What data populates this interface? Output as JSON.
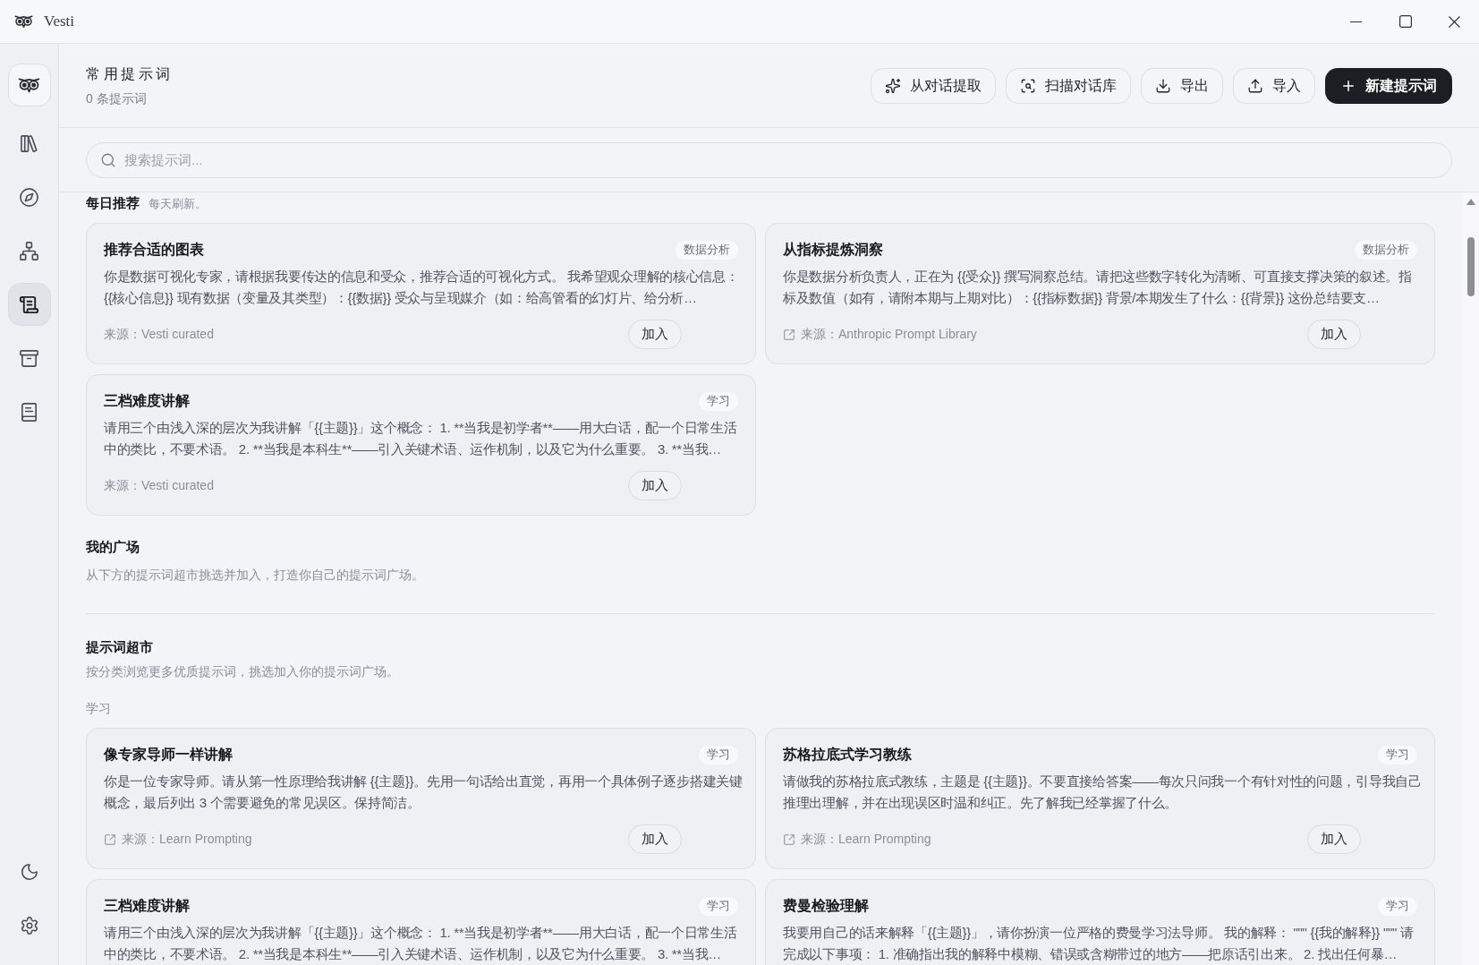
{
  "window": {
    "title": "Vesti"
  },
  "sidebar": {
    "items": [
      {
        "selected": false
      },
      {
        "selected": false
      },
      {
        "selected": false
      },
      {
        "selected": true
      },
      {
        "selected": false
      },
      {
        "selected": false
      }
    ]
  },
  "header": {
    "title": "常用提示词",
    "count": "0 条提示词",
    "buttons": [
      {
        "label": "从对话提取",
        "primary": false
      },
      {
        "label": "扫描对话库",
        "primary": false
      },
      {
        "label": "导出",
        "primary": false
      },
      {
        "label": "导入",
        "primary": false
      },
      {
        "label": "新建提示词",
        "primary": true
      }
    ]
  },
  "search": {
    "placeholder": "搜索提示词..."
  },
  "daily": {
    "title": "每日推荐",
    "note": "每天刷新。",
    "cards": [
      {
        "title": "推荐合适的图表",
        "tag": "数据分析",
        "description": "你是数据可视化专家，请根据我要传达的信息和受众，推荐合适的可视化方式。 我希望观众理解的核心信息：{{核心信息}} 现有数据（变量及其类型）：{{数据}} 受众与呈现媒介（如：给高管看的幻灯片、给分析…",
        "source": "来源：Vesti curated",
        "external": false,
        "action": "加入"
      },
      {
        "title": "从指标提炼洞察",
        "tag": "数据分析",
        "description": "你是数据分析负责人，正在为 {{受众}} 撰写洞察总结。请把这些数字转化为清晰、可直接支撑决策的叙述。指标及数值（如有，请附本期与上期对比）：{{指标数据}} 背景/本期发生了什么：{{背景}} 这份总结要支…",
        "source": "来源：Anthropic Prompt Library",
        "external": true,
        "action": "加入"
      },
      {
        "title": "三档难度讲解",
        "tag": "学习",
        "description": "请用三个由浅入深的层次为我讲解「{{主题}}」这个概念： 1. **当我是初学者**——用大白话，配一个日常生活中的类比，不要术语。 2. **当我是本科生**——引入关键术语、运作机制，以及它为什么重要。 3. **当我…",
        "source": "来源：Vesti curated",
        "external": false,
        "action": "加入"
      }
    ]
  },
  "my_square": {
    "title": "我的广场",
    "description": "从下方的提示词超市挑选并加入，打造你自己的提示词广场。"
  },
  "market": {
    "title": "提示词超市",
    "description": "按分类浏览更多优质提示词，挑选加入你的提示词广场。",
    "categories": [
      {
        "name": "学习",
        "cards": [
          {
            "title": "像专家导师一样讲解",
            "tag": "学习",
            "description": "你是一位专家导师。请从第一性原理给我讲解 {{主题}}。先用一句话给出直觉，再用一个具体例子逐步搭建关键概念，最后列出 3 个需要避免的常见误区。保持简洁。",
            "source": "来源：Learn Prompting",
            "external": true,
            "action": "加入"
          },
          {
            "title": "苏格拉底式学习教练",
            "tag": "学习",
            "description": "请做我的苏格拉底式教练，主题是 {{主题}}。不要直接给答案——每次只问我一个有针对性的问题，引导我自己推理出理解，并在出现误区时温和纠正。先了解我已经掌握了什么。",
            "source": "来源：Learn Prompting",
            "external": true,
            "action": "加入"
          },
          {
            "title": "三档难度讲解",
            "tag": "学习",
            "description": "请用三个由浅入深的层次为我讲解「{{主题}}」这个概念： 1. **当我是初学者**——用大白话，配一个日常生活中的类比，不要术语。 2. **当我是本科生**——引入关键术语、运作机制，以及它为什么重要。 3. **当我…"
          },
          {
            "title": "费曼检验理解",
            "tag": "学习",
            "description": "我要用自己的话来解释「{{主题}}」，请你扮演一位严格的费曼学习法导师。 我的解释： \"\"\" {{我的解释}} \"\"\" 请完成以下事项： 1. 准确指出我的解释中模糊、错误或含糊带过的地方——把原话引出来。 2. 找出任何暴…"
          }
        ]
      }
    ]
  }
}
